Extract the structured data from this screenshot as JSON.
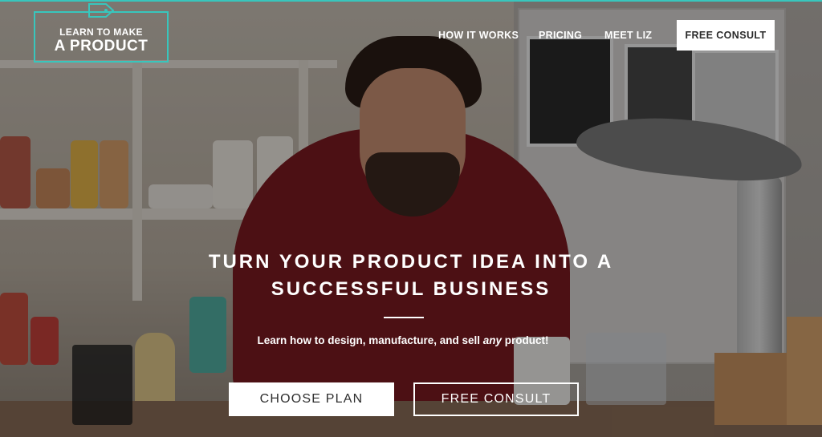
{
  "brand": {
    "line1": "LEARN TO MAKE",
    "line2": "A PRODUCT",
    "accent_color": "#38c6bd",
    "icon": "price-tag-icon"
  },
  "nav": {
    "items": [
      {
        "label": "HOW IT WORKS"
      },
      {
        "label": "PRICING"
      },
      {
        "label": "MEET LIZ"
      }
    ],
    "cta_label": "FREE CONSULT"
  },
  "hero": {
    "headline_line1": "TURN YOUR PRODUCT IDEA INTO A",
    "headline_line2": "SUCCESSFUL BUSINESS",
    "sub_before": "Learn how to design, manufacture, and sell ",
    "sub_emphasis": "any",
    "sub_after": " product!",
    "primary_button": "CHOOSE PLAN",
    "secondary_button": "FREE CONSULT"
  }
}
